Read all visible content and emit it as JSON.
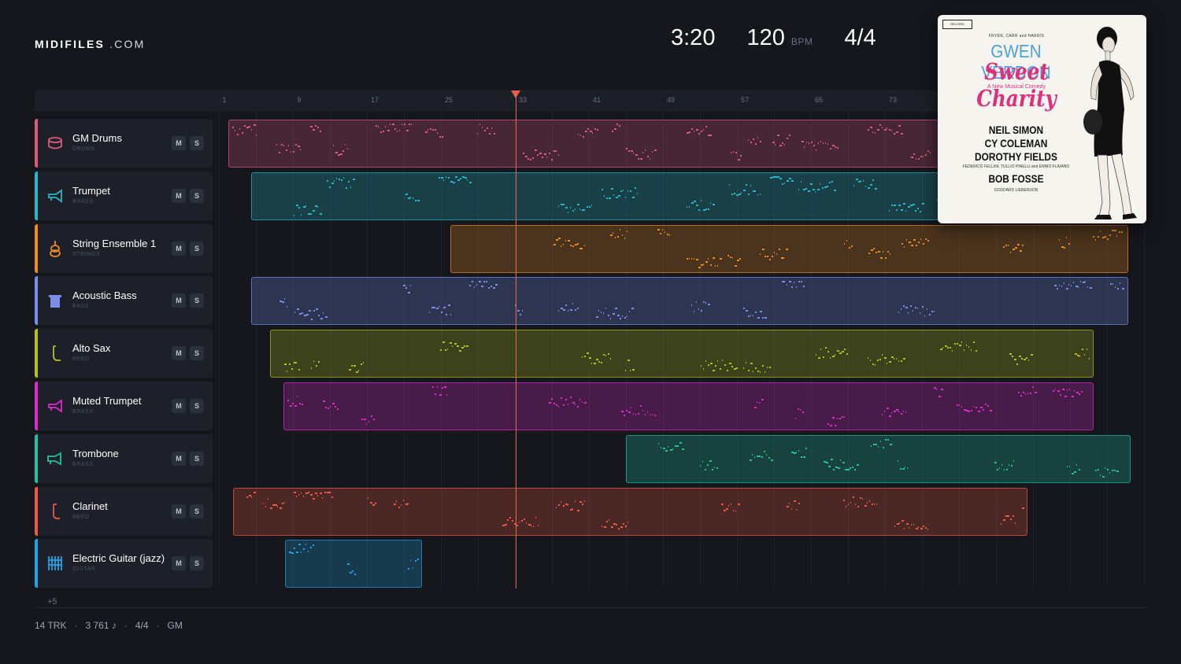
{
  "brand": {
    "bold": "MIDIFILES",
    "rest": " .COM"
  },
  "transport": {
    "time": "3:20",
    "tempo": "120",
    "tempo_unit": "BPM",
    "meter": "4/4"
  },
  "ruler": {
    "labels": [
      "1",
      "9",
      "17",
      "25",
      "33",
      "41",
      "49",
      "57",
      "65",
      "73"
    ]
  },
  "colors": {
    "background": "#15171d",
    "playhead": "#e8604a"
  },
  "tracks": [
    {
      "name": "GM Drums",
      "category": "DRUMS",
      "color": "#e0587e",
      "icon": "drum-icon",
      "mute": "M",
      "solo": "S"
    },
    {
      "name": "Trumpet",
      "category": "BRASS",
      "color": "#29b6c9",
      "icon": "trumpet-icon",
      "mute": "M",
      "solo": "S"
    },
    {
      "name": "String Ensemble 1",
      "category": "STRINGS",
      "color": "#ee8a1e",
      "icon": "violin-icon",
      "mute": "M",
      "solo": "S"
    },
    {
      "name": "Acoustic Bass",
      "category": "BASS",
      "color": "#7b8fea",
      "icon": "bass-icon",
      "mute": "M",
      "solo": "S"
    },
    {
      "name": "Alto Sax",
      "category": "REED",
      "color": "#b2c21a",
      "icon": "sax-icon",
      "mute": "M",
      "solo": "S"
    },
    {
      "name": "Muted Trumpet",
      "category": "BRASS",
      "color": "#e02ad0",
      "icon": "trumpet-icon",
      "mute": "M",
      "solo": "S"
    },
    {
      "name": "Trombone",
      "category": "BRASS",
      "color": "#1ec2a2",
      "icon": "trombone-icon",
      "mute": "M",
      "solo": "S"
    },
    {
      "name": "Clarinet",
      "category": "REED",
      "color": "#ee5a45",
      "icon": "clarinet-icon",
      "mute": "M",
      "solo": "S"
    },
    {
      "name": "Electric Guitar (jazz)",
      "category": "GUITAR",
      "color": "#1ea4e8",
      "icon": "guitar-icon",
      "mute": "M",
      "solo": "S"
    }
  ],
  "more_tracks": "+5",
  "footer": {
    "tracks": "14 TRK",
    "notes": "3 761 ♪",
    "meter": "4/4",
    "standard": "GM"
  },
  "cover": {
    "label": "RECORD",
    "presenters": "FRYER, CARR and HARRIS",
    "star": "GWEN VERDON",
    "show": "Sweet Charity",
    "subtitle": "A New Musical Comedy",
    "credit1": "NEIL SIMON",
    "credit2": "CY COLEMAN",
    "credit3": "DOROTHY FIELDS",
    "based_on": "FEDERICO FELLINI, TULLIO PINELLI and ENNIO FLAIANO",
    "director": "BOB FOSSE",
    "producer": "GODDARD LIEBERSON"
  }
}
